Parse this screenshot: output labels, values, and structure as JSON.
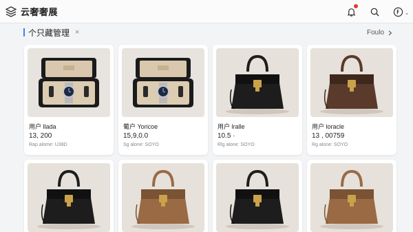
{
  "header": {
    "app_title": "云奢奢展",
    "icons": [
      "logo-icon",
      "bell-icon",
      "search-icon",
      "account-icon"
    ]
  },
  "section": {
    "title": "个只藏管理",
    "close": "×",
    "more_label": "Foulo",
    "more_icon": "chevron-right-icon"
  },
  "items": [
    {
      "name": "用户 llada",
      "price": "13, 200",
      "meta": "Rap alome: U38D",
      "kind": "watch-box"
    },
    {
      "name": "葡户 Yoricoe",
      "price": "15,9,0.0",
      "meta": "Sg alone: SOYO",
      "kind": "watch-box"
    },
    {
      "name": "用户 lralle",
      "price": "10.5 ·",
      "meta": "Rlg alone: SOYO",
      "kind": "bag-black"
    },
    {
      "name": "用户 loracle",
      "price": "13 , 00759",
      "meta": "Rg alone: SOYO",
      "kind": "bag-brown"
    },
    {
      "name": "",
      "price": "",
      "meta": "",
      "kind": "bag-black"
    },
    {
      "name": "",
      "price": "",
      "meta": "",
      "kind": "bag-tan"
    },
    {
      "name": "",
      "price": "",
      "meta": "",
      "kind": "bag-black"
    },
    {
      "name": "",
      "price": "",
      "meta": "",
      "kind": "bag-tan"
    }
  ],
  "colors": {
    "accent": "#3b82f6",
    "badge": "#e53935",
    "bag_black": "#1d1d1d",
    "bag_brown": "#5a3a2a",
    "bag_tan": "#9a6a44",
    "gold": "#c9a24a"
  }
}
